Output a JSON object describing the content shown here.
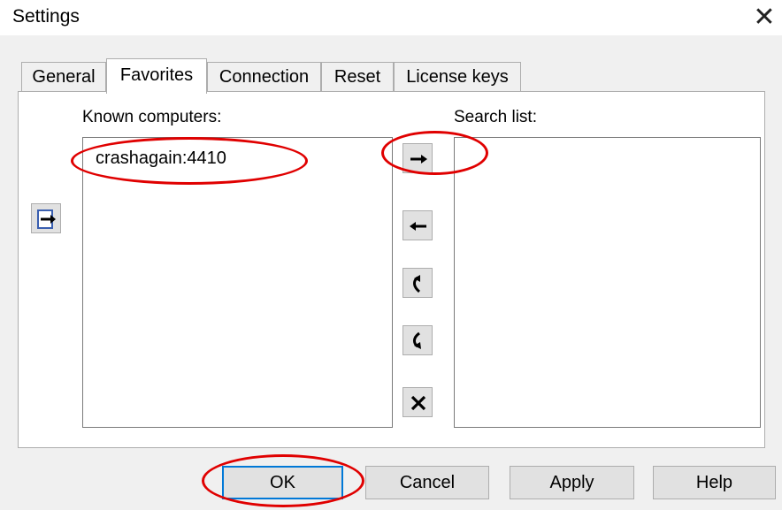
{
  "window": {
    "title": "Settings",
    "close_glyph": "✕"
  },
  "tabs": [
    {
      "label": "General",
      "active": false
    },
    {
      "label": "Favorites",
      "active": true
    },
    {
      "label": "Connection",
      "active": false
    },
    {
      "label": "Reset",
      "active": false
    },
    {
      "label": "License keys",
      "active": false
    }
  ],
  "favorites": {
    "known_label": "Known computers:",
    "known_items": [
      "crashagain:4410"
    ],
    "search_label": "Search list:",
    "search_items": [],
    "icons": {
      "import": "import-arrow-icon",
      "add": "arrow-right-icon",
      "remove": "arrow-left-icon",
      "move_up": "curved-arrow-up-icon",
      "move_down": "curved-arrow-down-icon",
      "delete": "delete-x-icon"
    }
  },
  "buttons": {
    "ok": "OK",
    "cancel": "Cancel",
    "apply": "Apply",
    "help": "Help"
  },
  "annotation_color": "#e00000"
}
